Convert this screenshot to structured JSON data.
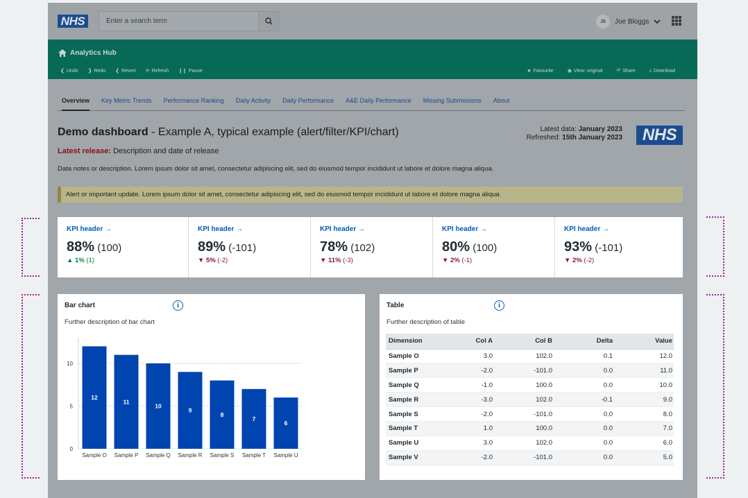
{
  "search": {
    "placeholder": "Enter a search term"
  },
  "user": {
    "initials": "JB",
    "name": "Joe Bloggs"
  },
  "brand": {
    "logo_text": "NHS",
    "hub_title": "Analytics Hub"
  },
  "toolbar": {
    "undo": "Undo",
    "redo": "Redo",
    "revert": "Revert",
    "refresh": "Refresh",
    "pause": "Pause",
    "favourite": "Favourite",
    "view_original": "View: original",
    "share": "Share",
    "download": "Download"
  },
  "tabs": [
    "Overview",
    "Key Metric Trends",
    "Performance Ranking",
    "Daily Activity",
    "Daily Performance",
    "A&E Daily Performance",
    "Missing Submissions",
    "About"
  ],
  "header": {
    "title_bold": "Demo dashboard",
    "title_rest": " - Example A, typical example (alert/filter/KPI/chart)",
    "release_label": "Latest release:",
    "release_text": " Description and date of release",
    "latest_label": "Latest data: ",
    "latest_value": "January 2023",
    "refreshed_label": "Refreshed: ",
    "refreshed_value": "15th January 2023",
    "notes": "Data notes or description. Lorem ipsum dolor sit amet, consectetur adipiscing elit, sed do eiusmod tempor incididunt ut labore et dolore magna aliqua."
  },
  "alert": "Alert or important update. Lorem ipsum dolor sit amet, consectetur adipiscing elit, sed do eiusmod tempor incididunt ut labore et dolore magna aliqua.",
  "kpis": [
    {
      "header": "KPI header →",
      "value": "88%",
      "sub": " (100)",
      "arrow": "▲",
      "delta": "1%",
      "delta_sub": " (1)",
      "direction": "up"
    },
    {
      "header": "KPI header →",
      "value": "89%",
      "sub": " (-101)",
      "arrow": "▼",
      "delta": "5%",
      "delta_sub": " (-2)",
      "direction": "down"
    },
    {
      "header": "KPI header →",
      "value": "78%",
      "sub": " (102)",
      "arrow": "▼",
      "delta": "11%",
      "delta_sub": " (-3)",
      "direction": "down"
    },
    {
      "header": "KPI header →",
      "value": "80%",
      "sub": " (100)",
      "arrow": "▼",
      "delta": "2%",
      "delta_sub": " (-1)",
      "direction": "down"
    },
    {
      "header": "KPI header →",
      "value": "93%",
      "sub": " (-101)",
      "arrow": "▼",
      "delta": "2%",
      "delta_sub": " (-2)",
      "direction": "down"
    }
  ],
  "bar_panel": {
    "title": "Bar chart",
    "description": "Further description of bar chart"
  },
  "table_panel": {
    "title": "Table",
    "description": "Further description of table"
  },
  "table": {
    "columns": [
      "Dimension",
      "Col A",
      "Col B",
      "Delta",
      "Value"
    ],
    "rows": [
      [
        "Sample O",
        "3.0",
        "102.0",
        "0.1",
        "12.0"
      ],
      [
        "Sample P",
        "-2.0",
        "-101.0",
        "0.0",
        "11.0"
      ],
      [
        "Sample Q",
        "-1.0",
        "100.0",
        "0.0",
        "10.0"
      ],
      [
        "Sample R",
        "-3.0",
        "102.0",
        "-0.1",
        "9.0"
      ],
      [
        "Sample S",
        "-2.0",
        "-101.0",
        "0.0",
        "8.0"
      ],
      [
        "Sample T",
        "1.0",
        "100.0",
        "0.0",
        "7.0"
      ],
      [
        "Sample U",
        "3.0",
        "102.0",
        "0.0",
        "6.0"
      ],
      [
        "Sample V",
        "-2.0",
        "-101.0",
        "0.0",
        "5.0"
      ]
    ]
  },
  "chart_data": {
    "type": "bar",
    "categories": [
      "Sample O",
      "Sample P",
      "Sample Q",
      "Sample R",
      "Sample S",
      "Sample T",
      "Sample U"
    ],
    "values": [
      12,
      11,
      10,
      9,
      8,
      7,
      6
    ],
    "yticks": [
      0,
      5,
      10
    ],
    "ylim": [
      0,
      13
    ],
    "grid": true,
    "bar_color": "#0044b0"
  },
  "colors": {
    "nhs_blue": "#005eb8",
    "green_bar": "#066a57",
    "kpi_up": "#007f3b",
    "kpi_down": "#8a1538"
  }
}
